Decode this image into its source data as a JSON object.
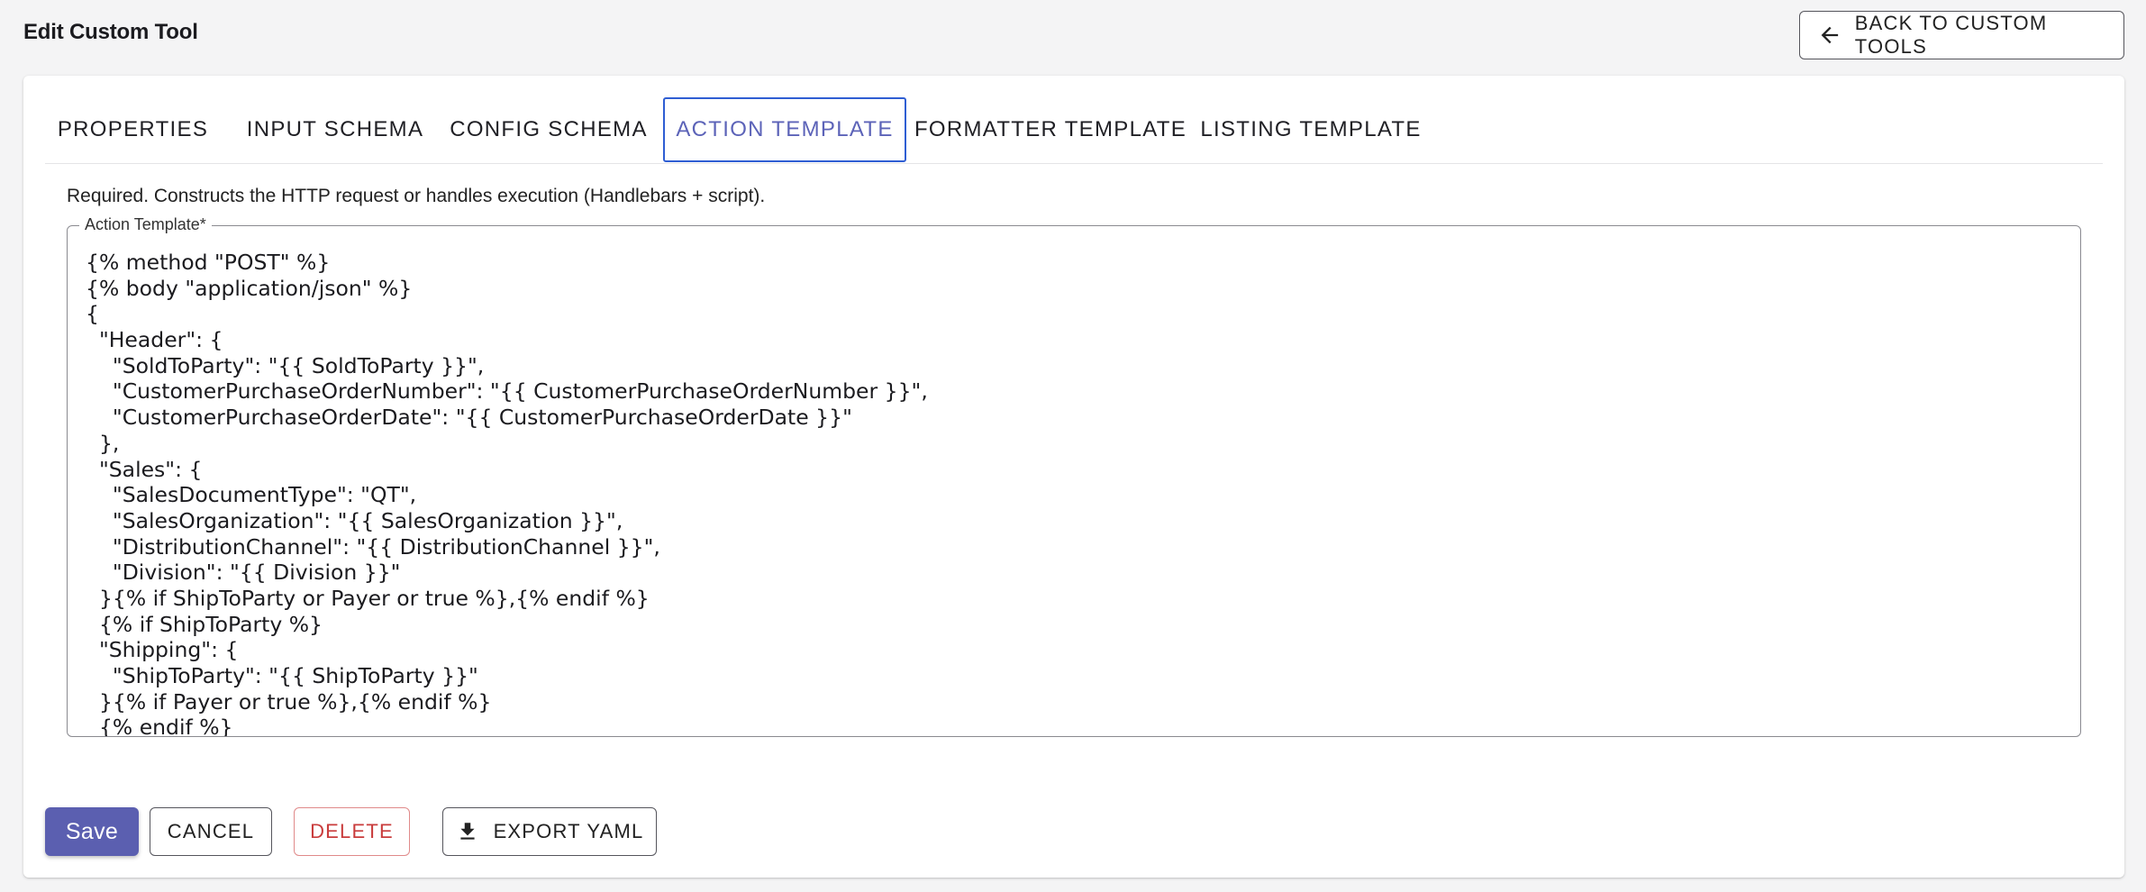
{
  "header": {
    "title": "Edit Custom Tool",
    "back_label": "BACK TO CUSTOM TOOLS"
  },
  "tabs": [
    {
      "label": "PROPERTIES",
      "active": false
    },
    {
      "label": "INPUT SCHEMA",
      "active": false
    },
    {
      "label": "CONFIG SCHEMA",
      "active": false
    },
    {
      "label": "ACTION TEMPLATE",
      "active": true
    },
    {
      "label": "FORMATTER TEMPLATE",
      "active": false
    },
    {
      "label": "LISTING TEMPLATE",
      "active": false
    }
  ],
  "helper_text": "Required. Constructs the HTTP request or handles execution (Handlebars + script).",
  "editor": {
    "label": "Action Template*",
    "lines": [
      "{% method \"POST\" %}",
      "{% body \"application/json\" %}",
      "{",
      "  \"Header\": {",
      "    \"SoldToParty\": \"{{ SoldToParty }}\",",
      "    \"CustomerPurchaseOrderNumber\": \"{{ CustomerPurchaseOrderNumber }}\",",
      "    \"CustomerPurchaseOrderDate\": \"{{ CustomerPurchaseOrderDate }}\"",
      "  },",
      "  \"Sales\": {",
      "    \"SalesDocumentType\": \"QT\",",
      "    \"SalesOrganization\": \"{{ SalesOrganization }}\",",
      "    \"DistributionChannel\": \"{{ DistributionChannel }}\",",
      "    \"Division\": \"{{ Division }}\"",
      "  }{% if ShipToParty or Payer or true %},{% endif %}",
      "  {% if ShipToParty %}",
      "  \"Shipping\": {",
      "    \"ShipToParty\": \"{{ ShipToParty }}\"",
      "  }{% if Payer or true %},{% endif %}",
      "  {% endif %}"
    ]
  },
  "actions": {
    "save_label": "Save",
    "cancel_label": "CANCEL",
    "delete_label": "DELETE",
    "export_label": "EXPORT YAML"
  },
  "colors": {
    "primary": "#5b5fb0",
    "active_tab_text": "#5c63b8",
    "active_tab_border": "#2f5ed3",
    "danger": "#c93c3c"
  }
}
